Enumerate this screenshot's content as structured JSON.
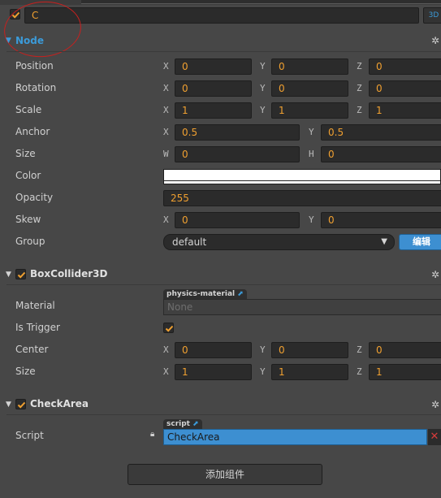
{
  "header": {
    "name_value": "C",
    "btn_3d": "3D",
    "enabled": true
  },
  "node": {
    "title": "Node",
    "position": {
      "label": "Position",
      "x_axis": "X",
      "x": "0",
      "y_axis": "Y",
      "y": "0",
      "z_axis": "Z",
      "z": "0"
    },
    "rotation": {
      "label": "Rotation",
      "x_axis": "X",
      "x": "0",
      "y_axis": "Y",
      "y": "0",
      "z_axis": "Z",
      "z": "0"
    },
    "scale": {
      "label": "Scale",
      "x_axis": "X",
      "x": "1",
      "y_axis": "Y",
      "y": "1",
      "z_axis": "Z",
      "z": "1"
    },
    "anchor": {
      "label": "Anchor",
      "x_axis": "X",
      "x": "0.5",
      "y_axis": "Y",
      "y": "0.5"
    },
    "size": {
      "label": "Size",
      "w_axis": "W",
      "w": "0",
      "h_axis": "H",
      "h": "0"
    },
    "color": {
      "label": "Color",
      "value": "#ffffff"
    },
    "opacity": {
      "label": "Opacity",
      "value": "255"
    },
    "skew": {
      "label": "Skew",
      "x_axis": "X",
      "x": "0",
      "y_axis": "Y",
      "y": "0"
    },
    "group": {
      "label": "Group",
      "value": "default",
      "edit_label": "编辑"
    }
  },
  "box_collider": {
    "title": "BoxCollider3D",
    "enabled": true,
    "material": {
      "label": "Material",
      "tag": "physics-material",
      "value": "None"
    },
    "is_trigger": {
      "label": "Is Trigger",
      "checked": true
    },
    "center": {
      "label": "Center",
      "x_axis": "X",
      "x": "0",
      "y_axis": "Y",
      "y": "0",
      "z_axis": "Z",
      "z": "0"
    },
    "size": {
      "label": "Size",
      "x_axis": "X",
      "x": "1",
      "y_axis": "Y",
      "y": "1",
      "z_axis": "Z",
      "z": "1"
    }
  },
  "check_area": {
    "title": "CheckArea",
    "enabled": true,
    "script": {
      "label": "Script",
      "tag": "script",
      "value": "CheckArea"
    }
  },
  "footer": {
    "add_component_label": "添加组件"
  },
  "colors": {
    "accent": "#3b9ad8",
    "value_text": "#f0a030",
    "checkbox": "#f0a030"
  }
}
